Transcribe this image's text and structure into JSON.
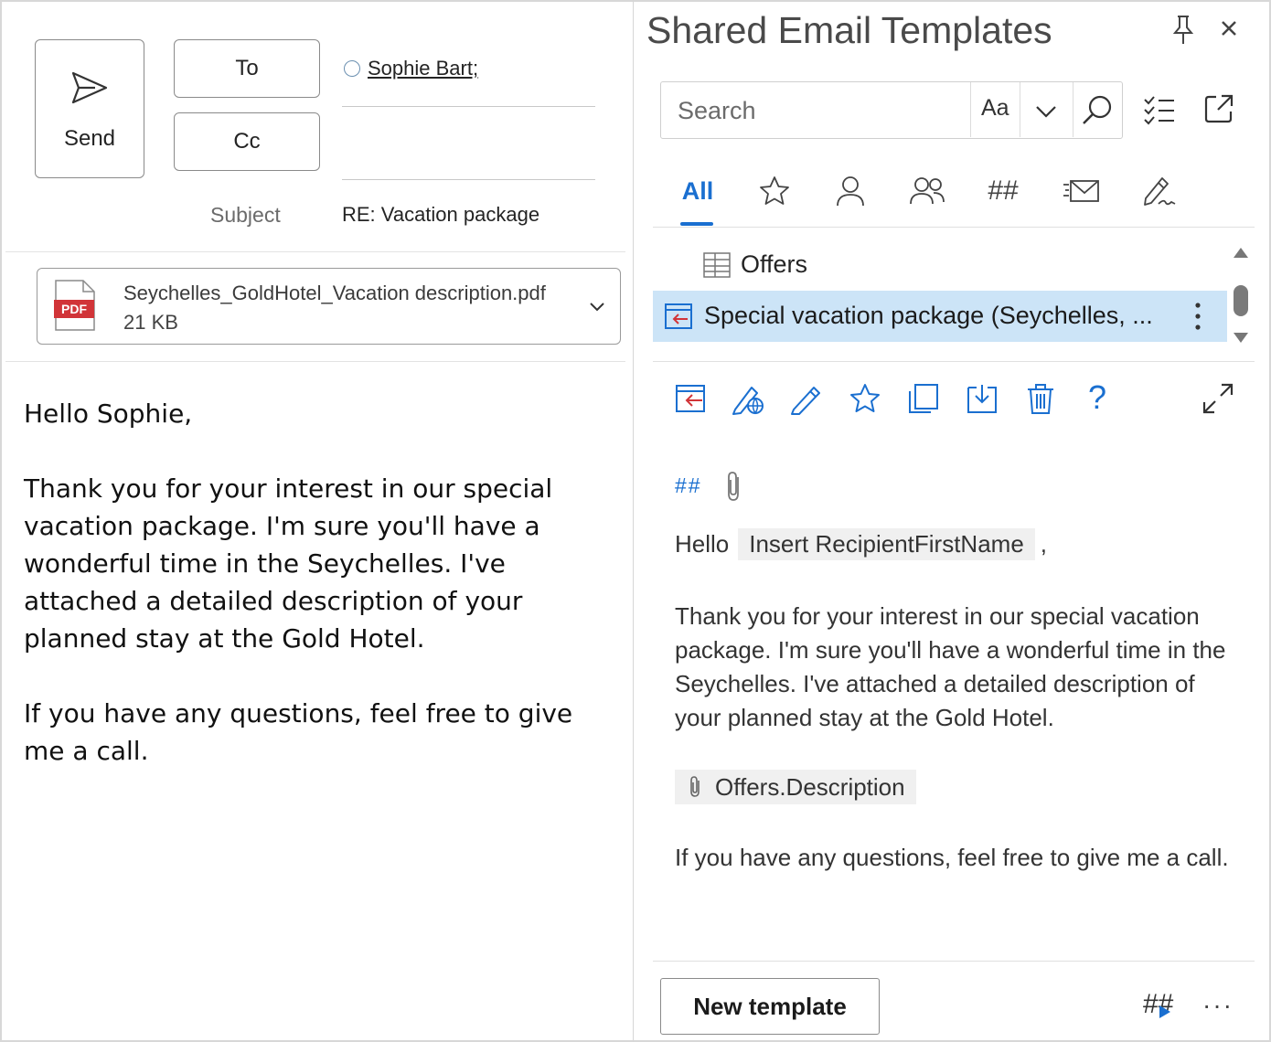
{
  "compose": {
    "send_label": "Send",
    "to_label": "To",
    "cc_label": "Cc",
    "recipient": "Sophie Bart;",
    "subject_label": "Subject",
    "subject_value": "RE: Vacation package",
    "attachment": {
      "badge": "PDF",
      "name": "Seychelles_GoldHotel_Vacation description.pdf",
      "size": "21 KB"
    },
    "body": {
      "p1": "Hello Sophie,",
      "p2": "Thank you for your interest in our special vacation package. I'm sure you'll have a wonderful time in the Seychelles. I've attached a detailed description of your planned stay at the Gold Hotel.",
      "p3": "If you have any questions, feel free to give me a call."
    }
  },
  "templates": {
    "title": "Shared Email Templates",
    "search_placeholder": "Search",
    "match_case_label": "Aa",
    "tabs": {
      "all": "All",
      "hash": "##"
    },
    "list": {
      "folder": "Offers",
      "selected_item": "Special vacation package (Seychelles, ..."
    },
    "preview": {
      "hashes": "##",
      "hello": "Hello",
      "macro": "Insert RecipientFirstName",
      "comma": ",",
      "body": "Thank you for your interest in our special vacation package. I'm sure you'll have a wonderful time in the Seychelles. I've attached a detailed description of your planned stay at the Gold Hotel.",
      "attachment_macro": "Offers.Description",
      "closing": "If you have any questions, feel free to give me a call."
    },
    "help_label": "?",
    "new_template_label": "New template",
    "hash_label": "##",
    "more_label": "···",
    "accent_color": "#1a6fd0",
    "selected_color": "#cce4f7"
  }
}
